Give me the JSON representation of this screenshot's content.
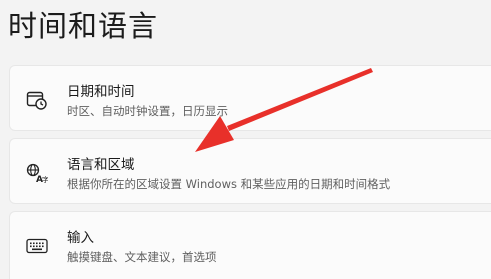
{
  "page": {
    "title": "时间和语言"
  },
  "settings": [
    {
      "id": "date-time",
      "icon": "clock-calendar-icon",
      "label": "日期和时间",
      "description": "时区、自动时钟设置，日历显示"
    },
    {
      "id": "language-region",
      "icon": "language-globe-icon",
      "label": "语言和区域",
      "description": "根据你所在的区域设置 Windows 和某些应用的日期和时间格式"
    },
    {
      "id": "typing",
      "icon": "keyboard-icon",
      "label": "输入",
      "description": "触摸键盘、文本建议，首选项"
    }
  ],
  "annotation": {
    "arrow_color": "#e8302a"
  }
}
